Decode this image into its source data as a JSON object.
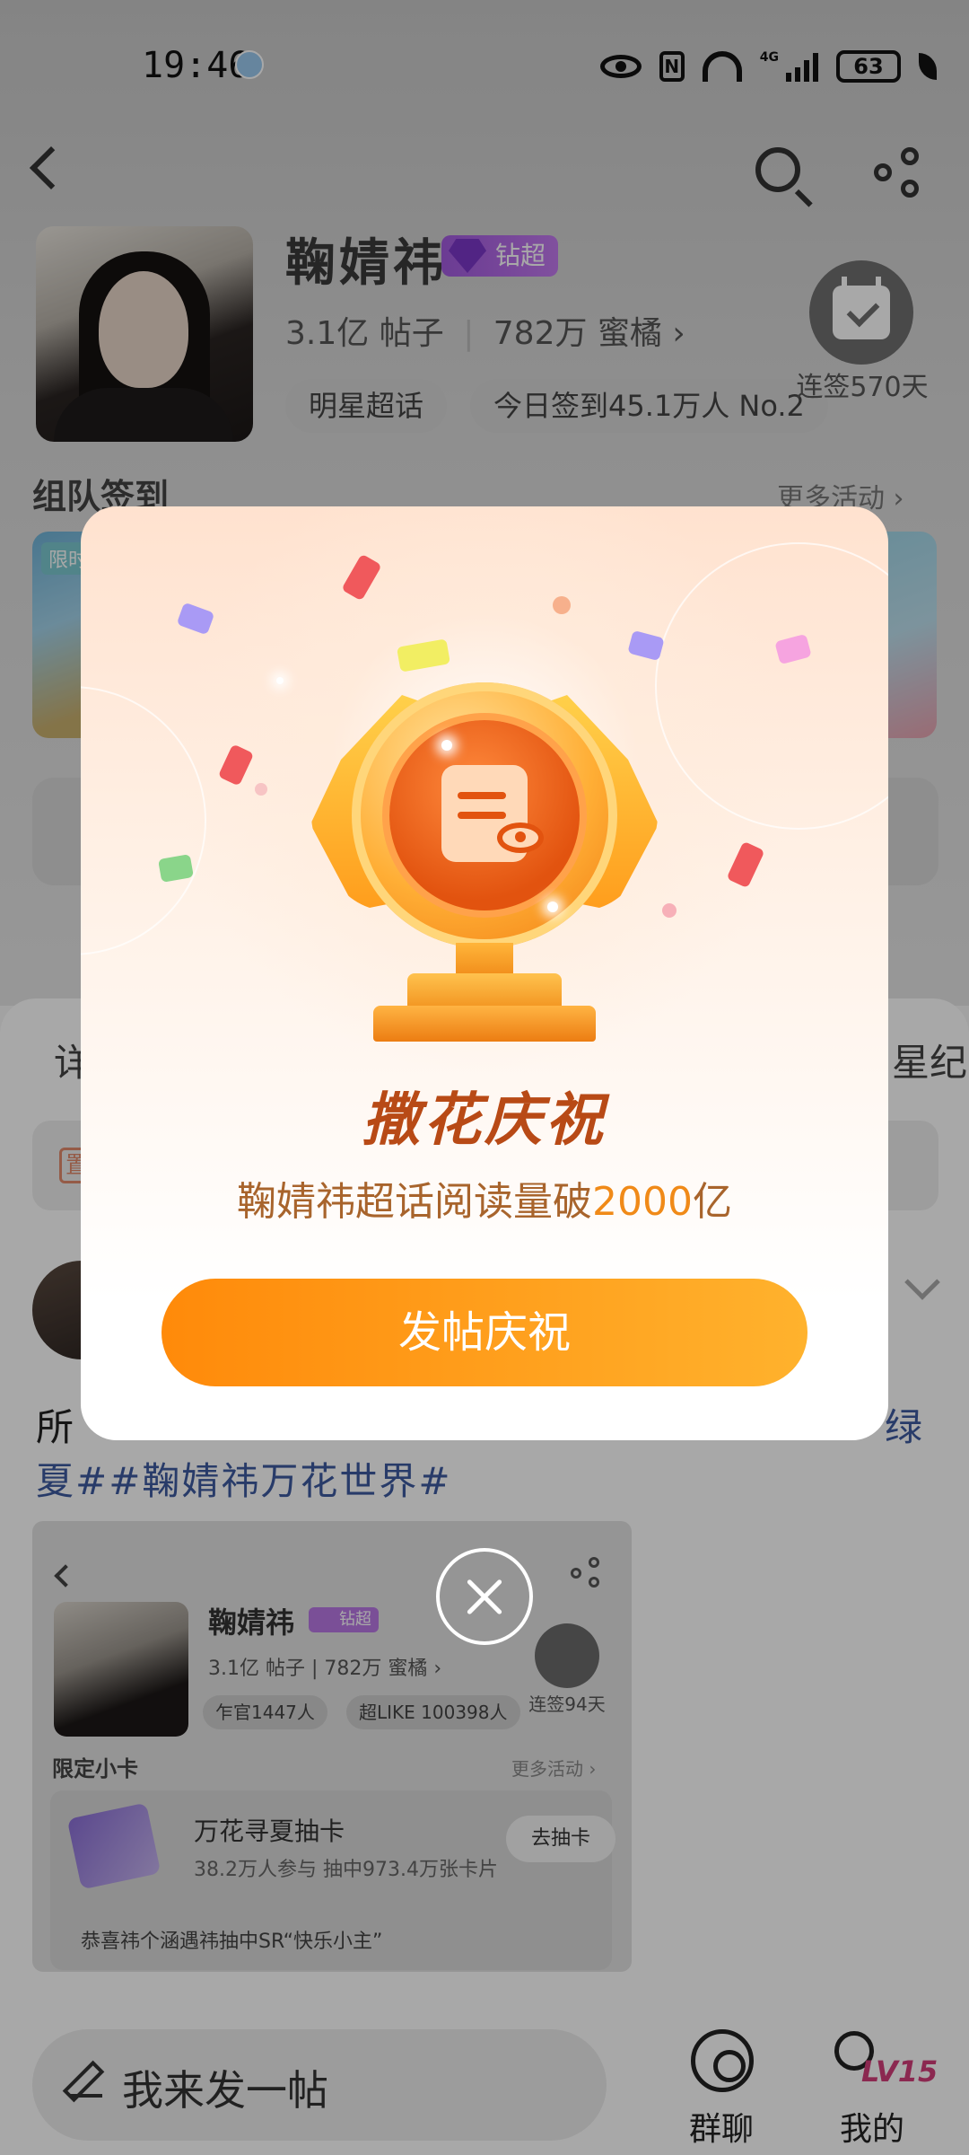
{
  "status_bar": {
    "time": "19:46",
    "network": "4G",
    "battery": "63"
  },
  "header": {
    "star_name": "鞠婧祎",
    "badge_label": "钻超",
    "posts_count": "3.1亿",
    "posts_label": "帖子",
    "fans_count": "782万",
    "fans_label": "蜜橘 ›",
    "chip_1": "明星超话",
    "chip_2": "今日签到45.1万人 No.2",
    "checkin_label": "连签570天"
  },
  "activity": {
    "section_title": "组队签到",
    "more_label": "更多活动 ›",
    "card_tag": "限时"
  },
  "lower": {
    "tab_left": "详",
    "tab_right": "星纪",
    "pinned_tag": "置",
    "post_text_line1_start": "所",
    "post_text_line1_end": "绿",
    "post_text_line2": "夏##鞠婧祎万花世界#"
  },
  "embedded_screenshot": {
    "name": "鞠婧祎",
    "badge": "钻超",
    "posts_count": "3.1亿",
    "posts_label": "帖子",
    "fans_count": "782万",
    "fans_label": "蜜橘 ›",
    "chip_1": "乍官1447人",
    "chip_2": "超LIKE 100398人",
    "checkin_label": "连签94天",
    "section_title": "限定小卡",
    "more_label": "更多活动 ›",
    "card_title": "万花寻夏抽卡",
    "card_sub": "38.2万人参与 抽中973.4万张卡片",
    "card_button": "去抽卡",
    "card_note": "恭喜祎个涵遇祎抽中SR“快乐小主”"
  },
  "bottom_bar": {
    "compose_placeholder": "我来发一帖",
    "group_chat_label": "群聊",
    "level": "LV15",
    "me_label": "我的"
  },
  "modal": {
    "title": "撒花庆祝",
    "subtitle_prefix": "鞠婧祎超话阅读量破",
    "subtitle_number": "2000",
    "subtitle_suffix": "亿",
    "button_label": "发帖庆祝"
  },
  "colors": {
    "modal_button_start": "#ff8a0a",
    "modal_button_end": "#ffb22d",
    "title_color": "#b84a16",
    "subtitle_color": "#a8642c",
    "highlight_color": "#f08a18",
    "badge_purple": "#a35be0",
    "level_color": "#d43e7a"
  },
  "icons": [
    "back-icon",
    "search-icon",
    "share-icon",
    "calendar-check-icon",
    "trophy-icon",
    "document-eye-icon",
    "close-icon",
    "pencil-icon",
    "group-chat-icon",
    "profile-icon"
  ]
}
